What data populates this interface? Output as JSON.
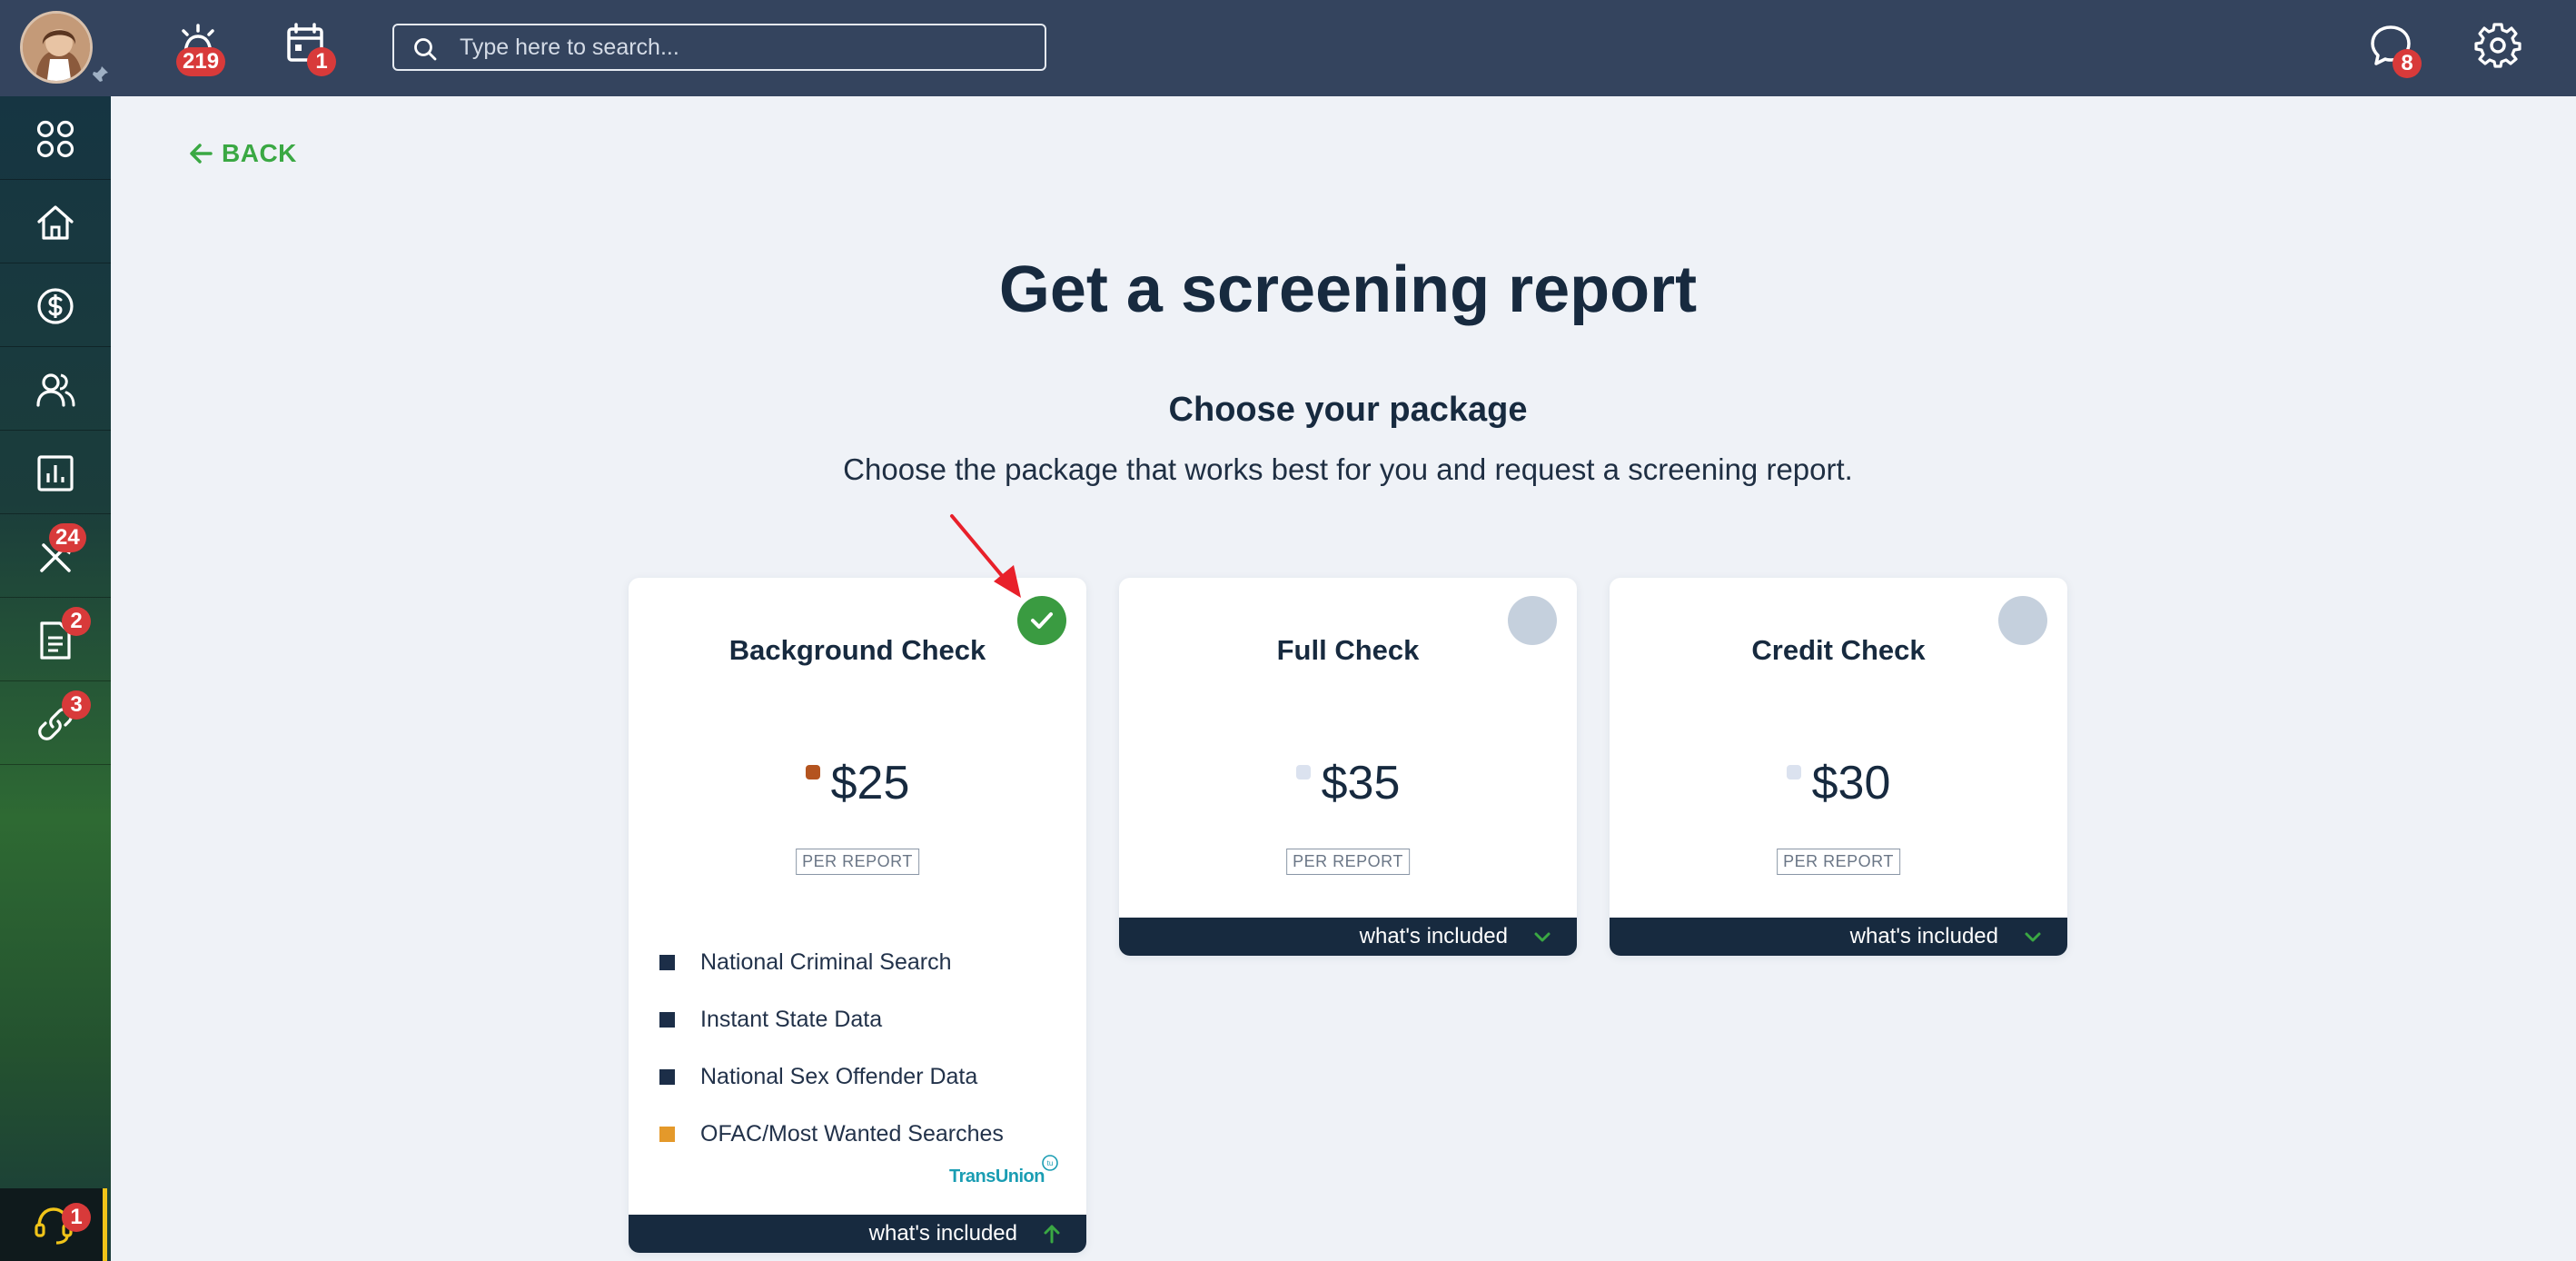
{
  "topbar": {
    "alerts_badge": "219",
    "calendar_badge": "1",
    "search_placeholder": "Type here to search...",
    "messages_badge": "8"
  },
  "sidebar": {
    "items": [
      {
        "icon": "apps-grid-icon",
        "badge": ""
      },
      {
        "icon": "home-icon",
        "badge": ""
      },
      {
        "icon": "dollar-icon",
        "badge": ""
      },
      {
        "icon": "people-icon",
        "badge": ""
      },
      {
        "icon": "bar-chart-icon",
        "badge": ""
      },
      {
        "icon": "tools-icon",
        "badge": "24"
      },
      {
        "icon": "document-icon",
        "badge": "2"
      },
      {
        "icon": "link-icon",
        "badge": "3"
      }
    ],
    "help_badge": "1"
  },
  "main": {
    "back_label": "BACK",
    "title": "Get a screening report",
    "subtitle": "Choose your package",
    "description": "Choose the package that works best for you and request a screening report."
  },
  "packages": [
    {
      "name": "Background Check",
      "price": "$25",
      "unit": "PER REPORT",
      "selected": true,
      "features": [
        "National Criminal Search",
        "Instant State Data",
        "National Sex Offender Data",
        "OFAC/Most Wanted Searches"
      ],
      "provider": "TransUnion",
      "included_label": "what's included"
    },
    {
      "name": "Full Check",
      "price": "$35",
      "unit": "PER REPORT",
      "selected": false,
      "included_label": "what's included"
    },
    {
      "name": "Credit Check",
      "price": "$30",
      "unit": "PER REPORT",
      "selected": false,
      "included_label": "what's included"
    }
  ],
  "colors": {
    "topbar": "#34445e",
    "accent_green": "#3aa843",
    "badge_red": "#d83a3a",
    "navy": "#172a3f",
    "page_bg": "#eff2f7"
  }
}
